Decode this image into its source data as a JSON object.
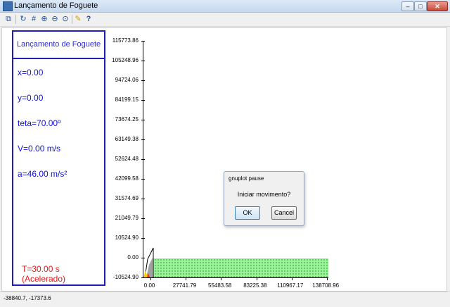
{
  "window": {
    "title": "Lançamento de Foguete",
    "app_icon": "gnuplot-window-icon",
    "controls": [
      "minimize",
      "maximize",
      "close"
    ]
  },
  "toolbar": {
    "icons": [
      "copy-icon",
      "replot-icon",
      "grid-icon",
      "zoom-in-icon",
      "zoom-out-icon",
      "zoom-fit-icon",
      "settings-icon",
      "help-icon"
    ]
  },
  "panel": {
    "title": "Lançamento de Foguete",
    "x": "x=0.00",
    "y": "y=0.00",
    "teta": "teta=70.00º",
    "v": "V=0.00 m/s",
    "a": "a=46.00 m/s²",
    "t": "T=30.00 s (Acelerado)"
  },
  "chart_data": {
    "type": "line",
    "yticks": [
      "115773.86",
      "105248.96",
      "94724.06",
      "84199.15",
      "73674.25",
      "63149.38",
      "52624.48",
      "42099.58",
      "31574.69",
      "21049.79",
      "10524.90",
      "0.00",
      "-10524.90"
    ],
    "xticks": [
      "0.00",
      "27741.79",
      "55483.58",
      "83225.38",
      "110967.17",
      "138708.96"
    ],
    "ylim": [
      -10524.9,
      115773.86
    ],
    "xlim": [
      0.0,
      138708.96
    ]
  },
  "dialog": {
    "title": "gnuplot pause",
    "message": "Iniciar movimento?",
    "ok_label": "OK",
    "cancel_label": "Cancel"
  },
  "status": {
    "coords": "-38840.7, -17373.6"
  },
  "colors": {
    "panel_border": "#1f1fb8",
    "panel_text": "#1010d8",
    "time_text": "#e21b1b",
    "ground_fill": "#9cf29c"
  }
}
